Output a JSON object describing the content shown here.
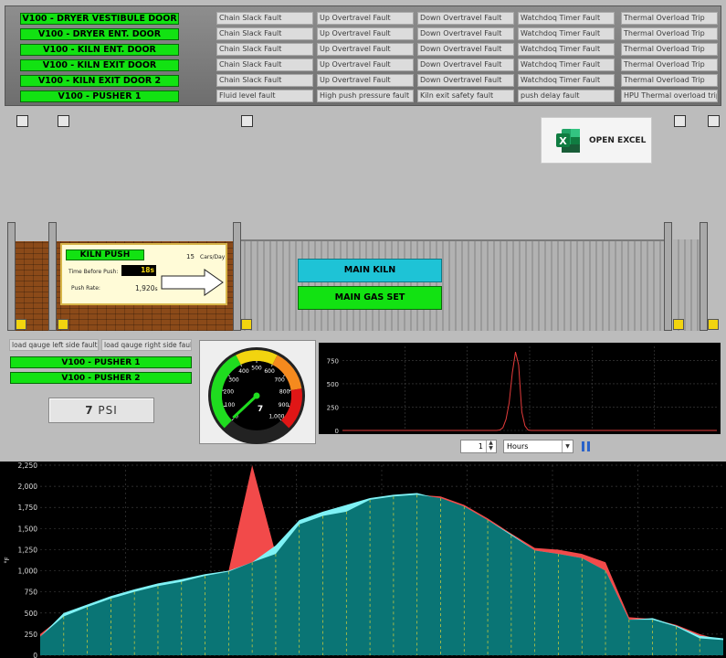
{
  "doors": [
    "V100 - DRYER VESTIBULE DOOR",
    "V100 - DRYER ENT. DOOR",
    "V100 - KILN ENT. DOOR",
    "V100 - KILN EXIT DOOR",
    "V100 - KILN EXIT DOOR 2",
    "V100 - PUSHER 1"
  ],
  "fault_rows": [
    [
      "Chain Slack Fault",
      "Up Overtravel Fault",
      "Down Overtravel Fault",
      "Watchdoq Timer Fault",
      "Thermal Overload Trip"
    ],
    [
      "Chain Slack Fault",
      "Up Overtravel Fault",
      "Down Overtravel Fault",
      "Watchdoq Timer Fault",
      "Thermal Overload Trip"
    ],
    [
      "Chain Slack Fault",
      "Up Overtravel Fault",
      "Down Overtravel Fault",
      "Watchdoq Timer Fault",
      "Thermal Overload Trip"
    ],
    [
      "Chain Slack Fault",
      "Up Overtravel Fault",
      "Down Overtravel Fault",
      "Watchdoq Timer Fault",
      "Thermal Overload Trip"
    ],
    [
      "Chain Slack Fault",
      "Up Overtravel Fault",
      "Down Overtravel Fault",
      "Watchdoq Timer Fault",
      "Thermal Overload Trip"
    ],
    [
      "Fluid level fault",
      "High push pressure fault",
      "Kiln exit safety fault",
      "push delay fault",
      "HPU Thermal overload trip"
    ]
  ],
  "excel": {
    "label": "OPEN EXCEL",
    "icon": "excel-icon"
  },
  "kiln_push": {
    "title": "KILN PUSH",
    "cars_value": "15",
    "cars_unit": "Cars/Day",
    "time_label": "Time Before Push:",
    "time_value": "18",
    "time_unit": "s",
    "rate_label": "Push Rate:",
    "rate_value": "1,920",
    "rate_unit": "s"
  },
  "buttons": {
    "main_kiln": "MAIN KILN",
    "main_gas_set": "MAIN GAS SET"
  },
  "load_faults": {
    "left": "load qauge left side fault",
    "right": "load qauge right side fault"
  },
  "pushers": [
    "V100 - PUSHER 1",
    "V100 - PUSHER 2"
  ],
  "pressure": {
    "value": "7",
    "unit": "PSI"
  },
  "gauge": {
    "value": 7,
    "min": 0,
    "max": 1000,
    "ticks": [
      "0",
      "100",
      "200",
      "300",
      "400",
      "500",
      "600",
      "700",
      "800",
      "900",
      "1,000"
    ],
    "readout": "7"
  },
  "trend_controls": {
    "count": "1",
    "period": "Hours"
  },
  "colors": {
    "green": "#12e212",
    "cyan": "#1ec3d6",
    "teal": "#0a7575",
    "lightcyan": "#7ff2f5",
    "red": "#f24a4a",
    "yellow": "#f2d40f"
  },
  "chart_data": [
    {
      "type": "line",
      "ylim": [
        0,
        900
      ],
      "yticks": [
        "0",
        "250",
        "500",
        "750"
      ],
      "series": [
        {
          "values": [
            0,
            0,
            0,
            0,
            0,
            0,
            0,
            0,
            0,
            0,
            0,
            0,
            0,
            0,
            0,
            0,
            0,
            0,
            0,
            0,
            0,
            0,
            0,
            0,
            0,
            0,
            0,
            0,
            0,
            0,
            0,
            0,
            0,
            0,
            0,
            0,
            0,
            0,
            0,
            0,
            0,
            0,
            0,
            0,
            0,
            0,
            0,
            0,
            0,
            0,
            5,
            30,
            120,
            300,
            620,
            840,
            700,
            200,
            50,
            5,
            0,
            0,
            0,
            0,
            0,
            0,
            0,
            0,
            0,
            0,
            0,
            0,
            0,
            0,
            0,
            0,
            0,
            0,
            0,
            0,
            0,
            0,
            0,
            0,
            0,
            0,
            0,
            0,
            0,
            0,
            0,
            0,
            0,
            0,
            0,
            0,
            0,
            0,
            0,
            0,
            0,
            0,
            0,
            0,
            0,
            0,
            0,
            0,
            0,
            0,
            0,
            0,
            0,
            0,
            0,
            0,
            0,
            0,
            0,
            0
          ]
        }
      ]
    },
    {
      "type": "area",
      "ylabel": "°F",
      "ylim": [
        0,
        2250
      ],
      "yticks": [
        "0",
        "250",
        "500",
        "750",
        "1,000",
        "1,250",
        "1,500",
        "1,750",
        "2,000",
        "2,250"
      ],
      "series": [
        {
          "values": [
            250,
            470,
            580,
            680,
            760,
            830,
            880,
            950,
            1000,
            2250,
            1200,
            1450,
            1540,
            1620,
            1700,
            1820,
            1900,
            1880,
            1780,
            1620,
            1440,
            1270,
            1250,
            1200,
            1100,
            450,
            430,
            360,
            250,
            170
          ]
        },
        {
          "values": [
            220,
            500,
            600,
            700,
            780,
            850,
            900,
            960,
            1000,
            1100,
            1300,
            1600,
            1700,
            1780,
            1860,
            1900,
            1920,
            1850,
            1760,
            1600,
            1430,
            1240,
            1200,
            1150,
            1000,
            420,
            440,
            350,
            230,
            200
          ]
        },
        {
          "values": [
            220,
            460,
            570,
            670,
            750,
            820,
            870,
            940,
            990,
            1100,
            1200,
            1550,
            1650,
            1700,
            1840,
            1880,
            1900,
            1860,
            1760,
            1600,
            1420,
            1240,
            1200,
            1150,
            1000,
            420,
            420,
            340,
            200,
            180
          ]
        }
      ]
    }
  ]
}
